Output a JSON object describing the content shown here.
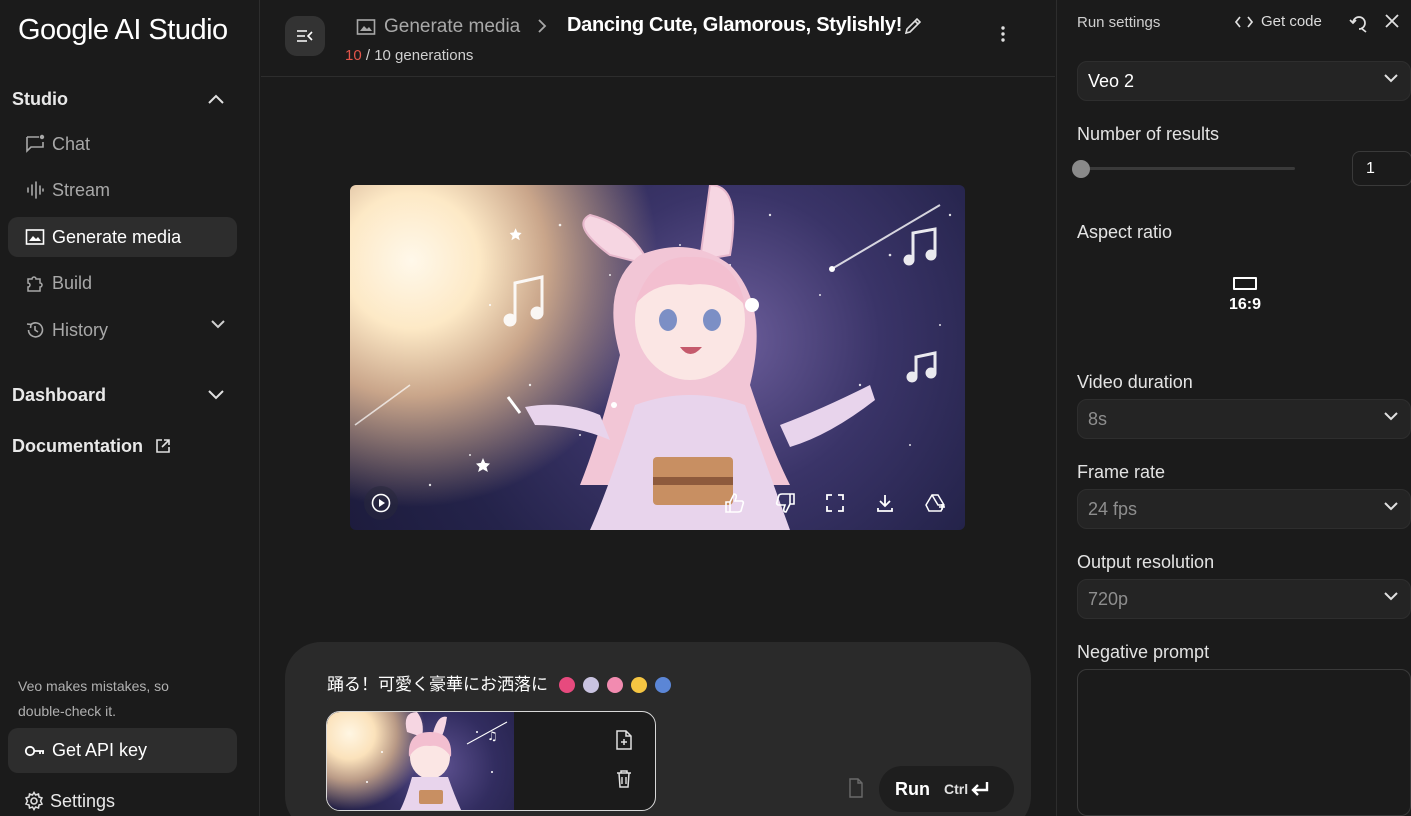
{
  "app": {
    "title": "Google AI Studio"
  },
  "sidebar": {
    "studio_label": "Studio",
    "items": [
      {
        "label": "Chat",
        "icon": "chat-icon"
      },
      {
        "label": "Stream",
        "icon": "stream-icon"
      },
      {
        "label": "Generate media",
        "icon": "image-icon",
        "active": true
      },
      {
        "label": "Build",
        "icon": "puzzle-icon"
      },
      {
        "label": "History",
        "icon": "history-icon"
      }
    ],
    "dashboard_label": "Dashboard",
    "documentation_label": "Documentation",
    "disclaimer": "Veo makes mistakes, so double-check it.",
    "api_key_label": "Get API key",
    "settings_label": "Settings"
  },
  "header": {
    "breadcrumb": "Generate media",
    "title": "Dancing Cute, Glamorous, Stylishly!",
    "generations_used": "10",
    "generations_rest": " / 10 generations"
  },
  "prompt": {
    "text": "踊る！可愛く豪華にお洒落に",
    "run_label": "Run",
    "run_shortcut": "Ctrl"
  },
  "run_settings": {
    "title": "Run settings",
    "get_code_label": "Get code",
    "model": "Veo 2",
    "number_of_results_label": "Number of results",
    "number_of_results": "1",
    "aspect_ratio_label": "Aspect ratio",
    "aspect_ratio": "16:9",
    "video_duration_label": "Video duration",
    "video_duration": "8s",
    "frame_rate_label": "Frame rate",
    "frame_rate": "24 fps",
    "output_resolution_label": "Output resolution",
    "output_resolution": "720p",
    "negative_prompt_label": "Negative prompt"
  },
  "colors": {
    "background": "#1b1b1b",
    "surface": "#2d2d2d",
    "accent_count": "#e2554a"
  }
}
